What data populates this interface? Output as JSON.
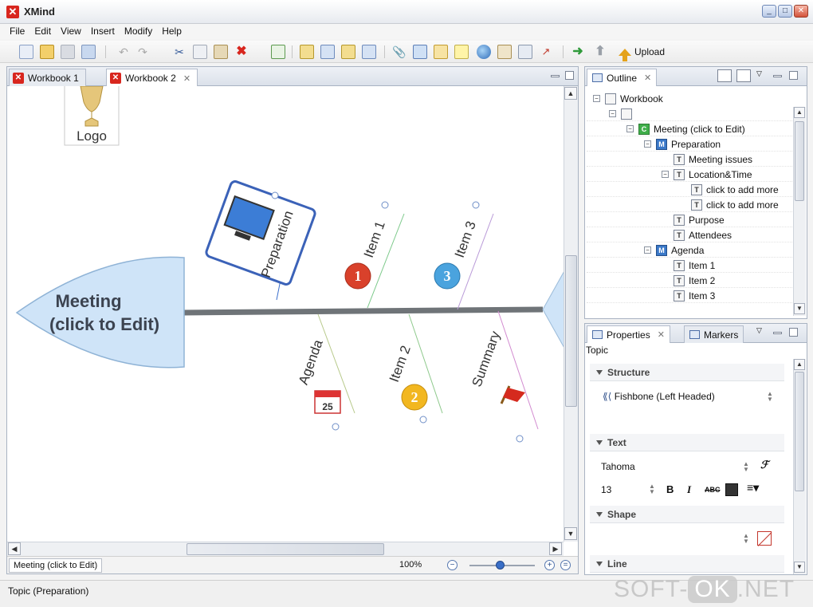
{
  "window": {
    "title": "XMind"
  },
  "menu": [
    "File",
    "Edit",
    "View",
    "Insert",
    "Modify",
    "Help"
  ],
  "toolbar": {
    "upload_label": "Upload"
  },
  "editor": {
    "tabs": [
      {
        "label": "Workbook 1"
      },
      {
        "label": "Workbook 2"
      }
    ],
    "map": {
      "logo_label": "Logo",
      "central_topic_line1": "Meeting",
      "central_topic_line2": "(click to Edit)",
      "upper_topics": [
        "Preparation",
        "Item 1",
        "Item 3"
      ],
      "lower_topics": [
        "Agenda",
        "Item 2",
        "Summary"
      ],
      "item1_marker": "1",
      "item2_marker": "2",
      "item3_marker": "3",
      "calendar_day": "25"
    },
    "breadcrumb": "Meeting (click to Edit)",
    "zoom": "100%"
  },
  "outline": {
    "tab_label": "Outline",
    "items": [
      {
        "label": "Workbook",
        "icon": "workbook-icon"
      },
      {
        "label": "",
        "icon": "sheet-icon"
      },
      {
        "label": "Meeting (click to Edit)",
        "icon": "C"
      },
      {
        "label": "Preparation",
        "icon": "M"
      },
      {
        "label": "Meeting issues",
        "icon": "T"
      },
      {
        "label": "Location&Time",
        "icon": "T"
      },
      {
        "label": "click to add more",
        "icon": "T"
      },
      {
        "label": "click to add more",
        "icon": "T"
      },
      {
        "label": "Purpose",
        "icon": "T"
      },
      {
        "label": "Attendees",
        "icon": "T"
      },
      {
        "label": "Agenda",
        "icon": "M"
      },
      {
        "label": "Item 1",
        "icon": "T"
      },
      {
        "label": "Item 2",
        "icon": "T"
      },
      {
        "label": "Item 3",
        "icon": "T"
      }
    ]
  },
  "properties": {
    "tab_label": "Properties",
    "markers_tab_label": "Markers",
    "heading": "Topic",
    "structure": {
      "title": "Structure",
      "value": "Fishbone (Left Headed)"
    },
    "text": {
      "title": "Text",
      "font": "Tahoma",
      "size": "13",
      "bold": "B",
      "italic": "I",
      "strike": "ABC",
      "color": "#333333"
    },
    "shape": {
      "title": "Shape"
    },
    "line": {
      "title": "Line"
    }
  },
  "status": {
    "message": "Topic (Preparation)"
  },
  "watermark": {
    "prefix": "SOFT-",
    "ok": "OK",
    "suffix": ".NET"
  },
  "colors": {
    "accent": "#3a6fc7",
    "brand_red": "#d8261e",
    "fish_fill": "#cfe4f8"
  }
}
